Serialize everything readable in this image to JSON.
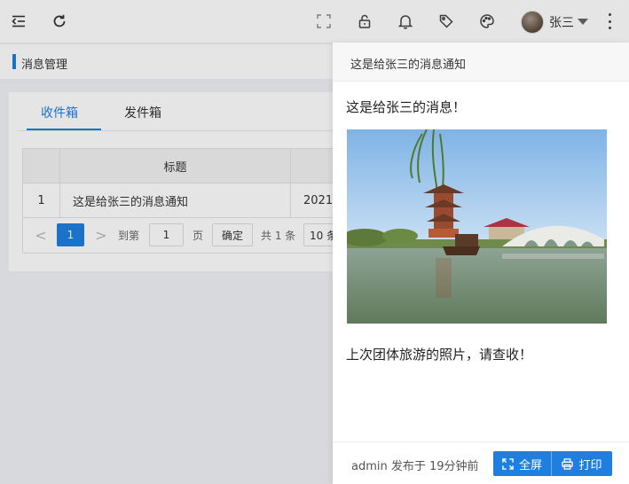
{
  "header": {
    "user_name": "张三"
  },
  "breadcrumb": {
    "title": "消息管理"
  },
  "tabs": [
    {
      "label": "收件箱",
      "active": true
    },
    {
      "label": "发件箱",
      "active": false
    }
  ],
  "table": {
    "headers": [
      "",
      "标题",
      ""
    ],
    "rows": [
      {
        "index": "1",
        "title": "这是给张三的消息通知",
        "date": "2021-"
      }
    ]
  },
  "pagination": {
    "prev": "<",
    "current_page": "1",
    "next": ">",
    "goto_label": "到第",
    "goto_value": "1",
    "page_label": "页",
    "confirm_label": "确定",
    "total_label": "共 1 条",
    "page_size": "10 条"
  },
  "drawer": {
    "title": "这是给张三的消息通知",
    "heading": "这是给张三的消息！",
    "body": "上次团体旅游的照片，请查收！",
    "meta": "admin 发布于 19分钟前",
    "fullscreen_label": "全屏",
    "print_label": "打印"
  },
  "colors": {
    "accent": "#1e7fe0",
    "mask": "rgba(0,0,0,0.1)"
  },
  "icons": [
    "menu-fold-icon",
    "refresh-icon",
    "fullscreen-icon",
    "lock-icon",
    "bell-icon",
    "tag-icon",
    "palette-icon",
    "more-vertical-icon",
    "expand-icon",
    "printer-icon"
  ]
}
